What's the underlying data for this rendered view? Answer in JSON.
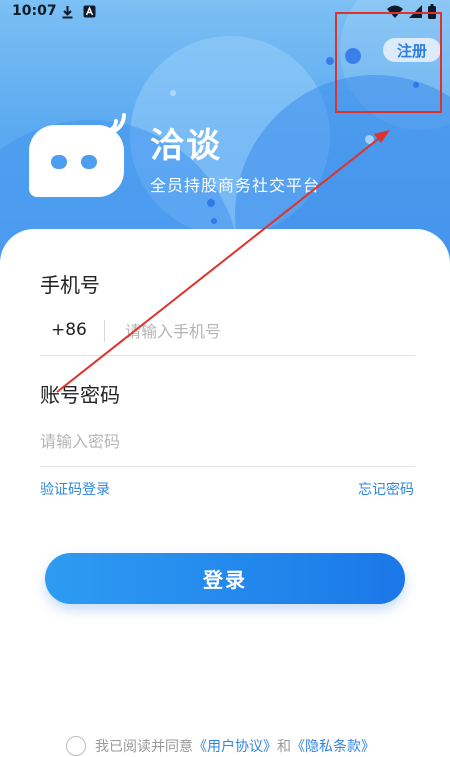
{
  "status_bar": {
    "time": "10:07",
    "icons": [
      "download-icon",
      "notification-a-icon",
      "wifi-icon",
      "signal-icon",
      "battery-icon"
    ]
  },
  "header": {
    "register_label": "注册",
    "app_name": "洽谈",
    "slogan": "全员持股商务社交平台"
  },
  "form": {
    "phone_label": "手机号",
    "country_code": "+86",
    "phone_placeholder": "请输入手机号",
    "phone_value": "",
    "password_label": "账号密码",
    "password_placeholder": "请输入密码",
    "password_value": "",
    "sms_login_label": "验证码登录",
    "forgot_password_label": "忘记密码",
    "login_button_label": "登录"
  },
  "agreement": {
    "prefix": "我已阅读并同意",
    "user_agreement": "《用户协议》",
    "and": "和",
    "privacy_policy": "《隐私条款》"
  },
  "annotation": {
    "highlight_color": "#e0322d",
    "arrow_color": "#e0322d"
  },
  "colors": {
    "brand_blue": "#2e7de0",
    "link_blue": "#2f86e0",
    "hero_gradient_top": "#7cc0f4",
    "hero_gradient_bottom": "#4d9ef0"
  }
}
